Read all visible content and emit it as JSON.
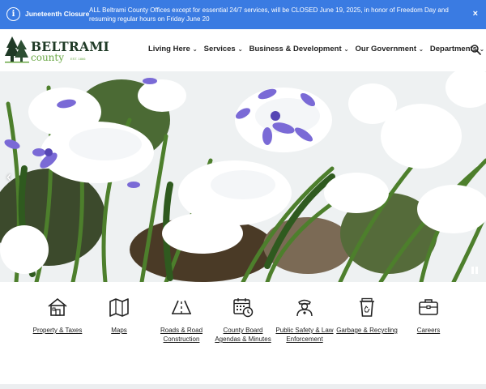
{
  "alert": {
    "title": "Juneteenth Closure",
    "message": "ALL Beltrami County Offices except for essential 24/7 services, will be CLOSED June 19, 2025, in honor of Freedom Day and resuming regular hours on Friday June 20",
    "icon": "info-icon",
    "close_label": "×",
    "color": "#3a7be2"
  },
  "logo": {
    "name": "BELTRAMI",
    "county": "county",
    "est": "EST. 1866"
  },
  "nav": {
    "items": [
      {
        "label": "Living Here"
      },
      {
        "label": "Services"
      },
      {
        "label": "Business & Development"
      },
      {
        "label": "Our Government"
      },
      {
        "label": "Departments"
      }
    ],
    "search_icon": "search-icon"
  },
  "hero": {
    "prev_label": "‹",
    "pause_icon": "pause-icon"
  },
  "quick_links": [
    {
      "label": "Property & Taxes",
      "icon": "house-icon"
    },
    {
      "label": "Maps",
      "icon": "map-icon"
    },
    {
      "label": "Roads & Road Construction",
      "icon": "road-icon"
    },
    {
      "label": "County Board Agendas & Minutes",
      "icon": "calendar-clock-icon"
    },
    {
      "label": "Public Safety & Law Enforcement",
      "icon": "officer-icon"
    },
    {
      "label": "Garbage & Recycling",
      "icon": "recycle-bin-icon"
    },
    {
      "label": "Careers",
      "icon": "briefcase-icon"
    }
  ]
}
